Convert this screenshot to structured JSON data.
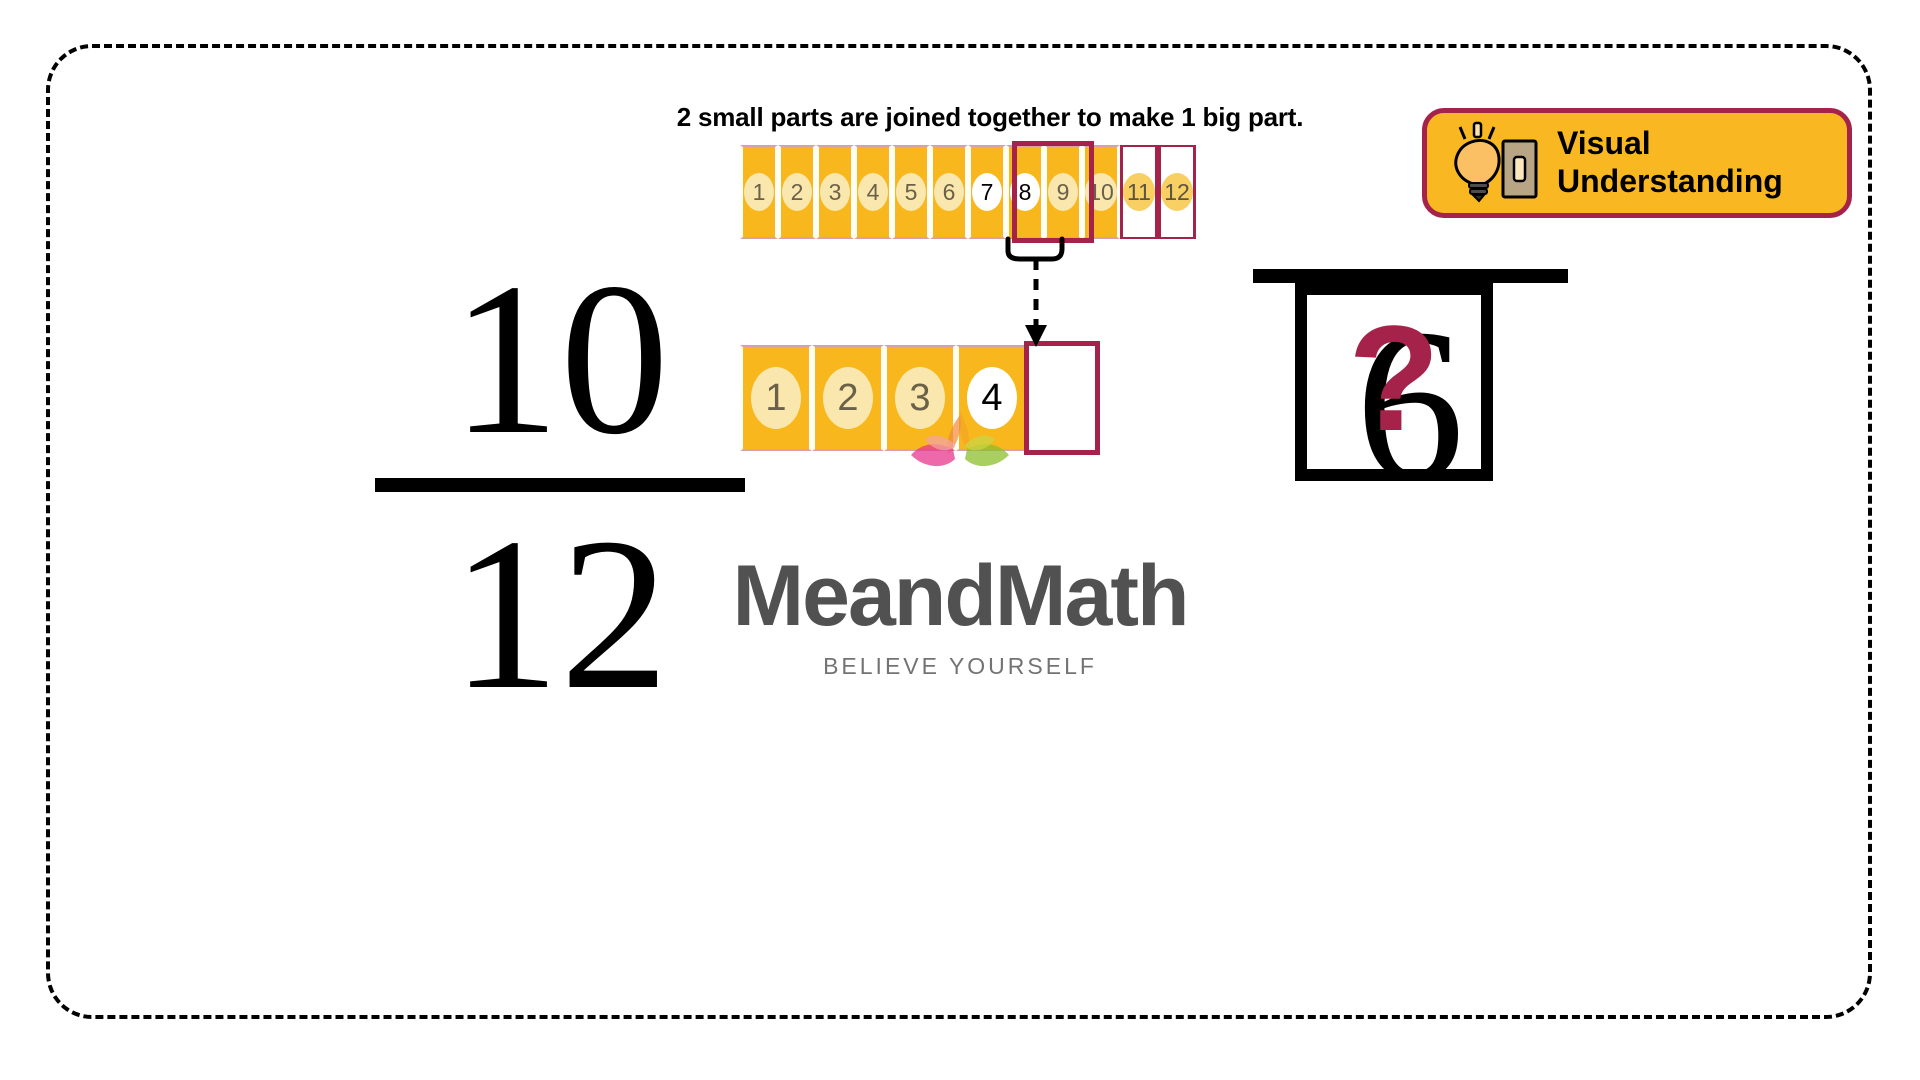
{
  "headline": "2 small parts are joined together to make 1 big part.",
  "badge": {
    "line1": "Visual",
    "line2": "Understanding",
    "icon": "lightbulb-switch-icon",
    "bg_color": "#F9B821",
    "border_color": "#A5234A"
  },
  "bar_top": {
    "total_cells": 12,
    "filled_cells": 10,
    "cells": [
      {
        "label": "1",
        "state": "filled"
      },
      {
        "label": "2",
        "state": "filled"
      },
      {
        "label": "3",
        "state": "filled"
      },
      {
        "label": "4",
        "state": "filled"
      },
      {
        "label": "5",
        "state": "filled"
      },
      {
        "label": "6",
        "state": "filled"
      },
      {
        "label": "7",
        "state": "highlighted"
      },
      {
        "label": "8",
        "state": "highlighted"
      },
      {
        "label": "9",
        "state": "filled"
      },
      {
        "label": "10",
        "state": "filled"
      },
      {
        "label": "11",
        "state": "empty"
      },
      {
        "label": "12",
        "state": "empty"
      }
    ],
    "grouped_labels": [
      "7",
      "8"
    ]
  },
  "bar_bottom": {
    "total_cells": 4,
    "cells": [
      {
        "label": "1",
        "state": "filled"
      },
      {
        "label": "2",
        "state": "filled"
      },
      {
        "label": "3",
        "state": "filled"
      },
      {
        "label": "4",
        "state": "highlighted"
      }
    ],
    "grouped_labels": [
      "4"
    ]
  },
  "fraction_left": {
    "numerator": "10",
    "denominator": "12"
  },
  "fraction_right": {
    "numerator": "",
    "denominator": "6",
    "numerator_placeholder": "?"
  },
  "question_mark": "?",
  "watermark": {
    "name": "MeandMath",
    "tagline": "BELIEVE YOURSELF"
  },
  "colors": {
    "cell_fill": "#F7B71D",
    "chip_fill": "#FAE7AE",
    "accent_red": "#A5234A",
    "badge_bg": "#F9B821",
    "frame_border": "#000000"
  }
}
